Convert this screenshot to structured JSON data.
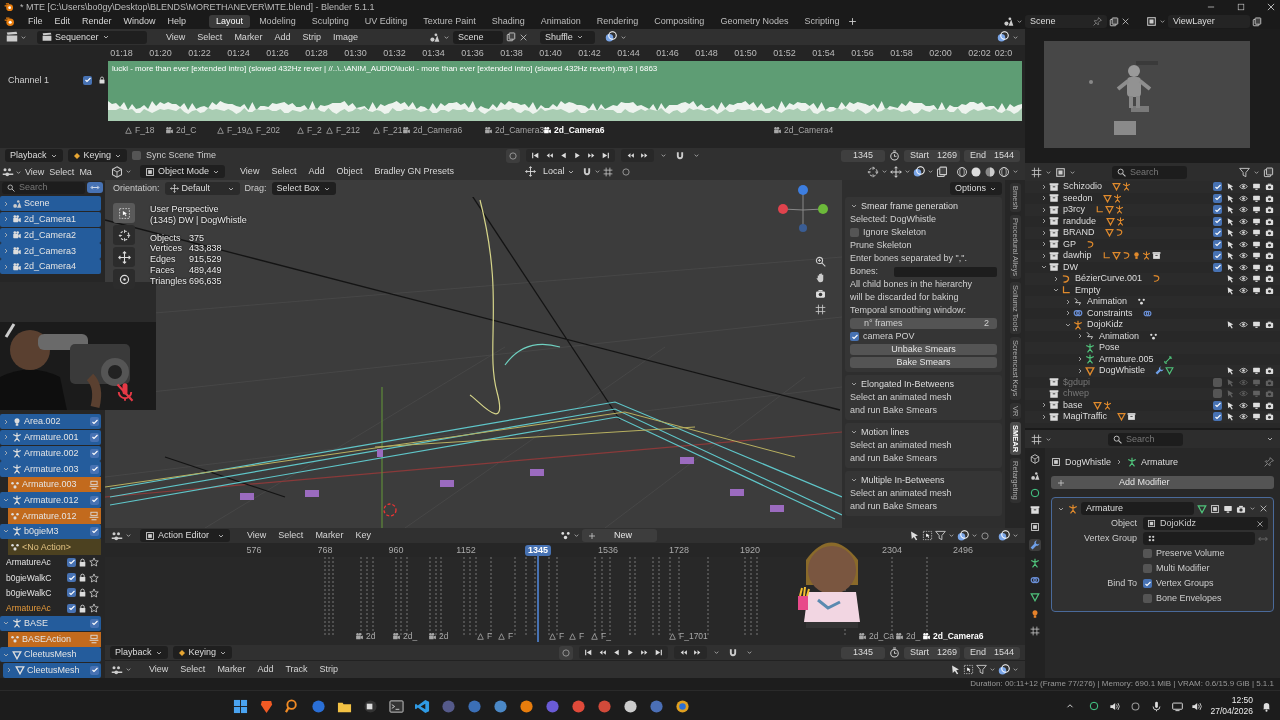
{
  "window": {
    "title": "* MTE [C:\\Users\\bo0gy\\Desktop\\BLENDS\\MORETHANEVER\\MTE.blend] - Blender 5.1.1"
  },
  "menu": [
    "File",
    "Edit",
    "Render",
    "Window",
    "Help"
  ],
  "workspaces": [
    {
      "label": "Layout",
      "selected": true
    },
    {
      "label": "Modeling",
      "selected": false
    },
    {
      "label": "Sculpting",
      "selected": false
    },
    {
      "label": "UV Editing",
      "selected": false
    },
    {
      "label": "Texture Paint",
      "selected": false
    },
    {
      "label": "Shading",
      "selected": false
    },
    {
      "label": "Animation",
      "selected": false
    },
    {
      "label": "Rendering",
      "selected": false
    },
    {
      "label": "Compositing",
      "selected": false
    },
    {
      "label": "Geometry Nodes",
      "selected": false
    },
    {
      "label": "Scripting",
      "selected": false
    }
  ],
  "scene": "Scene",
  "view_layer": "ViewLayer",
  "sequencer": {
    "editor": "Sequencer",
    "menu": [
      "View",
      "Select",
      "Marker",
      "Add",
      "Strip",
      "Image"
    ],
    "scene": "Scene",
    "overlap_mode": "Shuffle",
    "ticks": [
      "01:18",
      "01:20",
      "01:22",
      "01:24",
      "01:26",
      "01:28",
      "01:30",
      "01:32",
      "01:34",
      "01:36",
      "01:38",
      "01:40",
      "01:42",
      "01:44",
      "01:46",
      "01:48",
      "01:50",
      "01:52",
      "01:54",
      "01:56",
      "01:58",
      "02:00",
      "02:02",
      "02:0"
    ],
    "channel": {
      "label": "Channel 1",
      "checked": true
    },
    "strip": "lucki - more than ever [extended intro] (slowed 432Hz rever | //..\\..\\ANIM_AUDIO\\lucki - more than ever [extended intro] (slowed 432Hz reverb).mp3 | 6863",
    "markers": [
      {
        "label": "F_18",
        "kind": "frame",
        "selected": false
      },
      {
        "label": "2d_C",
        "kind": "camera",
        "selected": false
      },
      {
        "label": "F_19",
        "kind": "frame",
        "selected": false
      },
      {
        "label": "F_202",
        "kind": "frame",
        "selected": false
      },
      {
        "label": "F_2",
        "kind": "frame",
        "selected": false
      },
      {
        "label": "F_212",
        "kind": "frame",
        "selected": false
      },
      {
        "label": "F_21",
        "kind": "frame",
        "selected": false
      },
      {
        "label": "2d_Camera6",
        "kind": "camera",
        "selected": false
      },
      {
        "label": "2d_Camera3",
        "kind": "camera",
        "selected": false
      },
      {
        "label": "2d_Camera6",
        "kind": "camera",
        "selected": true
      },
      {
        "label": "2d_Camera4",
        "kind": "camera",
        "selected": false
      }
    ]
  },
  "timeline": {
    "playback": "Playback",
    "keying": "Keying",
    "sync": {
      "label": "Sync Scene Time",
      "checked": false
    },
    "frame": "1345",
    "start": {
      "label": "Start",
      "value": "1269"
    },
    "end": {
      "label": "End",
      "value": "1544"
    }
  },
  "channels": {
    "menu": [
      "View",
      "Select",
      "Ma"
    ],
    "search_placeholder": "Search",
    "top": [
      {
        "label": "Scene",
        "kind": "scene",
        "expanded": false
      },
      {
        "label": "2d_Camera1",
        "kind": "camera",
        "expanded": false
      },
      {
        "label": "2d_Camera2",
        "kind": "camera",
        "expanded": false
      },
      {
        "label": "2d_Camera3",
        "kind": "camera",
        "expanded": false
      },
      {
        "label": "2d_Camera4",
        "kind": "camera",
        "expanded": false
      }
    ],
    "bottom": [
      {
        "label": "Area.002",
        "kind": "light",
        "expanded": false,
        "checked": true
      },
      {
        "label": "Armature.001",
        "kind": "armature",
        "expanded": false,
        "checked": true
      },
      {
        "label": "Armature.002",
        "kind": "armature",
        "expanded": false,
        "checked": true
      },
      {
        "label": "Armature.003",
        "kind": "armature",
        "expanded": true,
        "checked": true
      },
      {
        "label": "Armature.003",
        "kind": "action"
      },
      {
        "label": "Armature.012",
        "kind": "armature",
        "expanded": true,
        "checked": true
      },
      {
        "label": "Armature.012",
        "kind": "action"
      },
      {
        "label": "b0gieM3",
        "kind": "armature",
        "expanded": true,
        "checked": true
      },
      {
        "label": "<No Action>",
        "kind": "no_action"
      },
      {
        "label": "ArmatureAc",
        "kind": "track",
        "checked": true,
        "selected": false
      },
      {
        "label": "b0gieWalkC",
        "kind": "track",
        "checked": true,
        "selected": false
      },
      {
        "label": "b0gieWalkC",
        "kind": "track",
        "checked": true,
        "selected": false
      },
      {
        "label": "ArmatureAc",
        "kind": "track",
        "checked": true,
        "selected": true
      },
      {
        "label": "BASE",
        "kind": "armature",
        "expanded": true,
        "checked": true
      },
      {
        "label": "BASEAction",
        "kind": "action"
      },
      {
        "label": "CleetusMesh",
        "kind": "mesh",
        "expanded": true
      },
      {
        "label": "CleetusMesh",
        "kind": "mesh_data",
        "expanded": false,
        "checked": true
      }
    ]
  },
  "viewport": {
    "mode": "Object Mode",
    "menu": [
      "View",
      "Select",
      "Add",
      "Object",
      "Bradley GN Presets"
    ],
    "pivot": "Local",
    "orientation": {
      "label": "Orientation:",
      "value": "Default"
    },
    "drag": {
      "label": "Drag:",
      "value": "Select Box"
    },
    "tools": [
      {
        "kind": "select_box",
        "selected": true
      },
      {
        "kind": "cursor",
        "selected": false
      },
      {
        "kind": "move",
        "selected": false
      },
      {
        "kind": "rotate",
        "selected": false
      }
    ],
    "info": [
      "User Perspective",
      "(1345) DW | DogWhistle"
    ],
    "stats": [
      {
        "label": "Objects",
        "value": "375"
      },
      {
        "label": "Vertices",
        "value": "433,838"
      },
      {
        "label": "Edges",
        "value": "915,529"
      },
      {
        "label": "Faces",
        "value": "489,449"
      },
      {
        "label": "Triangles",
        "value": "696,635"
      }
    ]
  },
  "sidebar": {
    "options": "Options",
    "sections": [
      {
        "title": "Smear frame generation",
        "expanded": true,
        "rows": [
          {
            "kind": "text",
            "text": "Selected: DogWhistle"
          },
          {
            "kind": "checkbox",
            "text": "Ignore Skeleton",
            "checked": false
          },
          {
            "kind": "text",
            "text": "Prune Skeleton"
          },
          {
            "kind": "text",
            "text": "Enter bones separated by \",\"."
          },
          {
            "kind": "field",
            "text": "Bones:"
          },
          {
            "kind": "text",
            "text": "All child bones in the hierarchy"
          },
          {
            "kind": "text",
            "text": "will be discarded for baking"
          },
          {
            "kind": "text",
            "text": "Temporal smoothing window:"
          },
          {
            "kind": "number",
            "text": "n° frames",
            "value": "2"
          },
          {
            "kind": "checkbox",
            "text": "camera POV",
            "checked": true
          },
          {
            "kind": "button",
            "text": "Unbake Smears"
          },
          {
            "kind": "button",
            "text": "Bake Smears"
          }
        ]
      },
      {
        "title": "Elongated In-Betweens",
        "expanded": true,
        "rows": [
          {
            "kind": "text",
            "text": "Select an animated mesh"
          },
          {
            "kind": "text",
            "text": "and run Bake Smears"
          }
        ]
      },
      {
        "title": "Motion lines",
        "expanded": true,
        "rows": [
          {
            "kind": "text",
            "text": "Select an animated mesh"
          },
          {
            "kind": "text",
            "text": "and run Bake Smears"
          }
        ]
      },
      {
        "title": "Multiple In-Betweens",
        "expanded": true,
        "rows": [
          {
            "kind": "text",
            "text": "Select an animated mesh"
          },
          {
            "kind": "text",
            "text": "and run Bake Smears"
          }
        ]
      }
    ],
    "tabs": [
      {
        "label": "Bmesh",
        "selected": false
      },
      {
        "label": "Procedural Alleys",
        "selected": false
      },
      {
        "label": "Sollumz Tools",
        "selected": false
      },
      {
        "label": "Screencast Keys",
        "selected": false
      },
      {
        "label": "VR",
        "selected": false
      },
      {
        "label": "SMEAR",
        "selected": true
      },
      {
        "label": "Retargeting",
        "selected": false
      }
    ]
  },
  "outliner": {
    "search_placeholder": "Search",
    "tree": [
      {
        "label": "Schizodio",
        "kind": "collection",
        "expanded": false,
        "checked": true,
        "contents": [
          {
            "kind": "mesh"
          },
          {
            "kind": "armature"
          }
        ]
      },
      {
        "label": "seedon",
        "kind": "collection",
        "expanded": false,
        "checked": true,
        "contents": [
          {
            "kind": "mesh"
          },
          {
            "kind": "armature"
          }
        ]
      },
      {
        "label": "p3rcy",
        "kind": "collection",
        "expanded": false,
        "checked": true,
        "contents": [
          {
            "kind": "empty"
          },
          {
            "kind": "mesh"
          },
          {
            "kind": "armature"
          }
        ]
      },
      {
        "label": "randude",
        "kind": "collection",
        "expanded": false,
        "checked": true,
        "contents": [
          {
            "kind": "mesh"
          },
          {
            "kind": "armature"
          }
        ]
      },
      {
        "label": "BRAND",
        "kind": "collection",
        "expanded": false,
        "checked": true,
        "contents": [
          {
            "kind": "mesh"
          },
          {
            "kind": "curve"
          }
        ]
      },
      {
        "label": "GP",
        "kind": "collection",
        "expanded": false,
        "checked": true,
        "contents": [
          {
            "kind": "curve"
          }
        ]
      },
      {
        "label": "dawhip",
        "kind": "collection",
        "expanded": false,
        "checked": true,
        "contents": [
          {
            "kind": "empty"
          },
          {
            "kind": "mesh"
          },
          {
            "kind": "curve"
          },
          {
            "kind": "light"
          },
          {
            "kind": "armature"
          },
          {
            "kind": "collection"
          }
        ]
      },
      {
        "label": "DW",
        "kind": "collection",
        "expanded": true,
        "checked": true,
        "children": [
          {
            "label": "BézierCurve.001",
            "kind": "curve",
            "expanded": false,
            "contents": [
              {
                "kind": "curve_data"
              }
            ]
          },
          {
            "label": "Empty",
            "kind": "empty",
            "expanded": true,
            "children": [
              {
                "label": "Animation",
                "kind": "animation",
                "expanded": false,
                "contents": [
                  {
                    "kind": "action"
                  }
                ]
              },
              {
                "label": "Constraints",
                "kind": "constraints",
                "expanded": false,
                "contents": [
                  {
                    "kind": "constraint"
                  }
                ]
              },
              {
                "label": "DojoKidz",
                "kind": "armature",
                "expanded": true,
                "children": [
                  {
                    "label": "Animation",
                    "kind": "animation",
                    "expanded": false,
                    "contents": [
                      {
                        "kind": "action"
                      }
                    ]
                  },
                  {
                    "label": "Pose",
                    "kind": "pose"
                  },
                  {
                    "label": "Armature.005",
                    "kind": "armature_data",
                    "expanded": false,
                    "contents": [
                      {
                        "kind": "bone"
                      }
                    ]
                  },
                  {
                    "label": "DogWhistle",
                    "kind": "mesh",
                    "expanded": false,
                    "contents": [
                      {
                        "kind": "modifier"
                      },
                      {
                        "kind": "mesh_data"
                      }
                    ]
                  }
                ]
              }
            ]
          }
        ]
      },
      {
        "label": "$gdupi",
        "kind": "collection",
        "checked": false
      },
      {
        "label": "chwep",
        "kind": "collection",
        "checked": false
      },
      {
        "label": "base",
        "kind": "collection",
        "expanded": false,
        "checked": true,
        "contents": [
          {
            "kind": "mesh"
          },
          {
            "kind": "armature"
          }
        ]
      },
      {
        "label": "MagiTraffic",
        "kind": "collection",
        "expanded": false,
        "checked": true,
        "contents": [
          {
            "kind": "mesh"
          },
          {
            "kind": "collection"
          }
        ]
      }
    ]
  },
  "properties": {
    "search_placeholder": "Search",
    "object": "DogWhistle",
    "modifier_crumb": "Armature",
    "add_modifier": "Add Modifier",
    "modifier": {
      "name": "Armature",
      "expanded": true,
      "object_label": "Object",
      "object": "DojoKidz",
      "vertex_group_label": "Vertex Group",
      "options": [
        {
          "label": "Preserve Volume",
          "checked": false
        },
        {
          "label": "Multi Modifier",
          "checked": false
        }
      ],
      "bind_label": "Bind To",
      "bind": [
        {
          "label": "Vertex Groups",
          "checked": true
        },
        {
          "label": "Bone Envelopes",
          "checked": false
        }
      ]
    }
  },
  "action_editor": {
    "editor": "Action Editor",
    "menu": [
      "View",
      "Select",
      "Marker",
      "Key"
    ],
    "new": "New",
    "ticks": [
      {
        "label": "576",
        "selected": false
      },
      {
        "label": "768",
        "selected": false
      },
      {
        "label": "960",
        "selected": false
      },
      {
        "label": "1152",
        "selected": false
      },
      {
        "label": "1345",
        "selected": true
      },
      {
        "label": "1536",
        "selected": false
      },
      {
        "label": "1728",
        "selected": false
      },
      {
        "label": "1920",
        "selected": false
      },
      {
        "label": "2304",
        "selected": false
      },
      {
        "label": "2496",
        "selected": false
      }
    ],
    "markers": [
      {
        "label": "2d",
        "kind": "camera",
        "selected": false
      },
      {
        "label": "2d_",
        "kind": "camera",
        "selected": false
      },
      {
        "label": "2d",
        "kind": "camera",
        "selected": false
      },
      {
        "label": "F",
        "kind": "frame",
        "selected": false
      },
      {
        "label": "F",
        "kind": "frame",
        "selected": false
      },
      {
        "label": "F",
        "kind": "frame",
        "selected": false
      },
      {
        "label": "F",
        "kind": "frame",
        "selected": false
      },
      {
        "label": "F_",
        "kind": "frame",
        "selected": false
      },
      {
        "label": "F_1701",
        "kind": "frame",
        "selected": false
      },
      {
        "label": "2d_Ca",
        "kind": "camera",
        "selected": false
      },
      {
        "label": "2d_",
        "kind": "camera",
        "selected": false
      },
      {
        "label": "2d_Camera6",
        "kind": "camera",
        "selected": true
      }
    ]
  },
  "playback_bar": {
    "playback": "Playback",
    "keying": "Keying",
    "frame": "1345",
    "start": {
      "label": "Start",
      "value": "1269"
    },
    "end": {
      "label": "End",
      "value": "1544"
    }
  },
  "nla": {
    "menu": [
      "View",
      "Select",
      "Marker",
      "Add",
      "Track",
      "Strip"
    ]
  },
  "status": "Duration: 00:11+12 (Frame 77/276) | Memory: 690.1 MiB | VRAM: 0.6/15.9 GiB | 5.1.1",
  "taskbar": {
    "time": "12:50",
    "date": "27/04/2026"
  }
}
